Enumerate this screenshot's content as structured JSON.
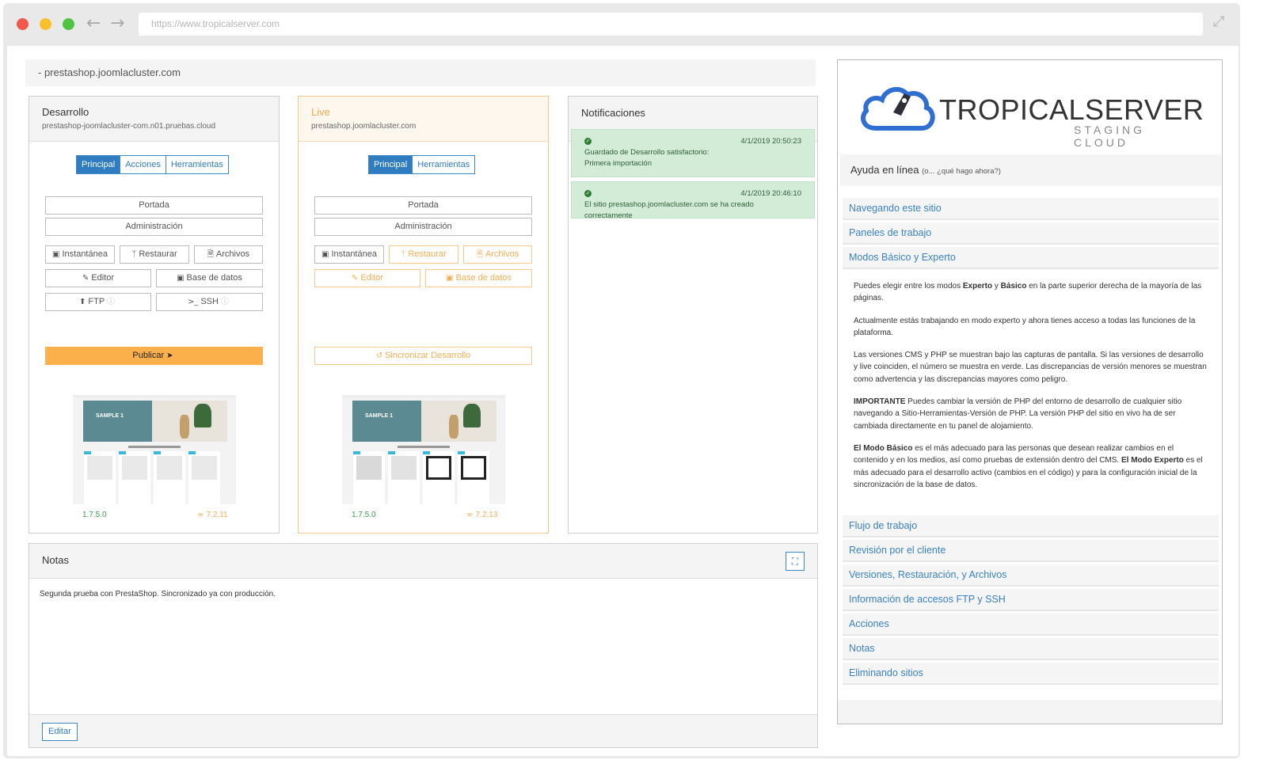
{
  "browser": {
    "url": "https://www.tropicalserver.com"
  },
  "site": {
    "header": "-  prestashop.joomlacluster.com"
  },
  "dev": {
    "title": "Desarrollo",
    "subtitle": "prestashop-joomlacluster-com.n01.pruebas.cloud",
    "tabs": [
      "Principal",
      "Acciones",
      "Herramientas"
    ],
    "portada": "Portada",
    "administracion": "Administración",
    "instantanea": "Instantánea",
    "restaurar": "Restaurar",
    "archivos": "Archivos",
    "editor": "Editor",
    "base_datos": "Base de datos",
    "ftp": "FTP",
    "ssh": "SSH",
    "publicar": "Publicar",
    "cms_version": "1.7.5.0",
    "php_version": "7.2.11"
  },
  "live": {
    "title": "Live",
    "subtitle": "prestashop.joomlacluster.com",
    "tabs": [
      "Principal",
      "Herramientas"
    ],
    "portada": "Portada",
    "administracion": "Administración",
    "instantanea": "Instantánea",
    "restaurar": "Restaurar",
    "archivos": "Archivos",
    "editor": "Editor",
    "base_datos": "Base de datos",
    "sincronizar": "Sincronizar Desarrollo",
    "cms_version": "1.7.5.0",
    "php_version": "7.2.13"
  },
  "thumbnail": {
    "banner_text": "SAMPLE 1"
  },
  "notifications": {
    "title": "Notificaciones",
    "items": [
      {
        "date": "4/1/2019 20:50:23",
        "line1": "Guardado de Desarrollo satisfactorio:",
        "line2": "Primera importación"
      },
      {
        "date": "4/1/2019 20:46:10",
        "line1": "El sitio prestashop.joomlacluster.com se ha creado correctamente",
        "line2": ""
      }
    ]
  },
  "notes": {
    "title": "Notas",
    "body": "Segunda prueba con PrestaShop. Sincronizado ya con producción.",
    "edit": "Editar"
  },
  "help": {
    "logo_main": "TROPICALSERVER",
    "logo_sub": "STAGING CLOUD",
    "title": "Ayuda en línea",
    "subtitle": "(o... ¿qué hago ahora?)",
    "items_top": [
      "Navegando este sitio",
      "Paneles de trabajo",
      "Modos Básico y Experto"
    ],
    "items_bottom": [
      "Flujo de trabajo",
      "Revisión por el cliente",
      "Versiones, Restauración, y Archivos",
      "Información de accesos FTP y SSH",
      "Acciones",
      "Notas",
      "Eliminando sitios"
    ],
    "p1_a": "Puedes elegir entre los modos ",
    "p1_b": "Experto",
    "p1_c": " y ",
    "p1_d": "Básico",
    "p1_e": " en la parte superior derecha de la mayoría de las páginas.",
    "p2": "Actualmente estás trabajando en modo experto y ahora tienes acceso a todas las funciones de la plataforma.",
    "p3": "Las versiones CMS y PHP se muestran bajo las capturas de pantalla. Si las versiones de desarrollo y live coinciden, el número se muestra en verde. Las discrepancias de versión menores se muestran como advertencia y las discrepancias mayores como peligro.",
    "p4_a": "IMPORTANTE",
    "p4_b": " Puedes cambiar la versión de PHP del entorno de desarrollo de cualquier sitio navegando a Sitio-Herramientas-Versión de PHP. La versión PHP del sitio en vivo ha de ser cambiada directamente en tu panel de alojamiento.",
    "p5_a": "El Modo Básico",
    "p5_b": " es el más adecuado para las personas que desean realizar cambios en el contenido y en los medios, así como pruebas de extensión dentro del CMS. ",
    "p5_c": "El Modo Experto",
    "p5_d": " es el más adecuado para el desarrollo activo (cambios en el código) y para la configuración inicial de la sincronización de la base de datos."
  },
  "colors": {
    "accent_blue": "#2f7cc1",
    "orange": "#fbb04b",
    "success_bg": "#d3ecd8"
  }
}
